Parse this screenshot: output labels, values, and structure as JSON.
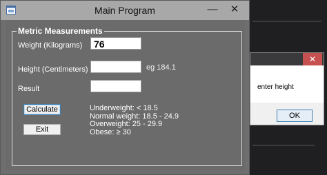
{
  "main_window": {
    "title": "Main Program",
    "minimize_glyph": "—",
    "close_glyph": "✕"
  },
  "group": {
    "label": "Metric Measurements",
    "weight_label": "Weight (Kilograms)",
    "weight_value": "76",
    "height_label": "Height (Centimeters)",
    "height_value": "",
    "height_hint": "eg 184.1",
    "result_label": "Result",
    "result_value": "",
    "calculate_label": "Calculate",
    "exit_label": "Exit",
    "bmi_categories": [
      "Underweight: < 18.5",
      "Normal weight: 18.5 - 24.9",
      "Overweight: 25 - 29.9",
      "Obese: ≥ 30"
    ]
  },
  "message_box": {
    "close_glyph": "✕",
    "text": "enter height",
    "ok_label": "OK"
  }
}
